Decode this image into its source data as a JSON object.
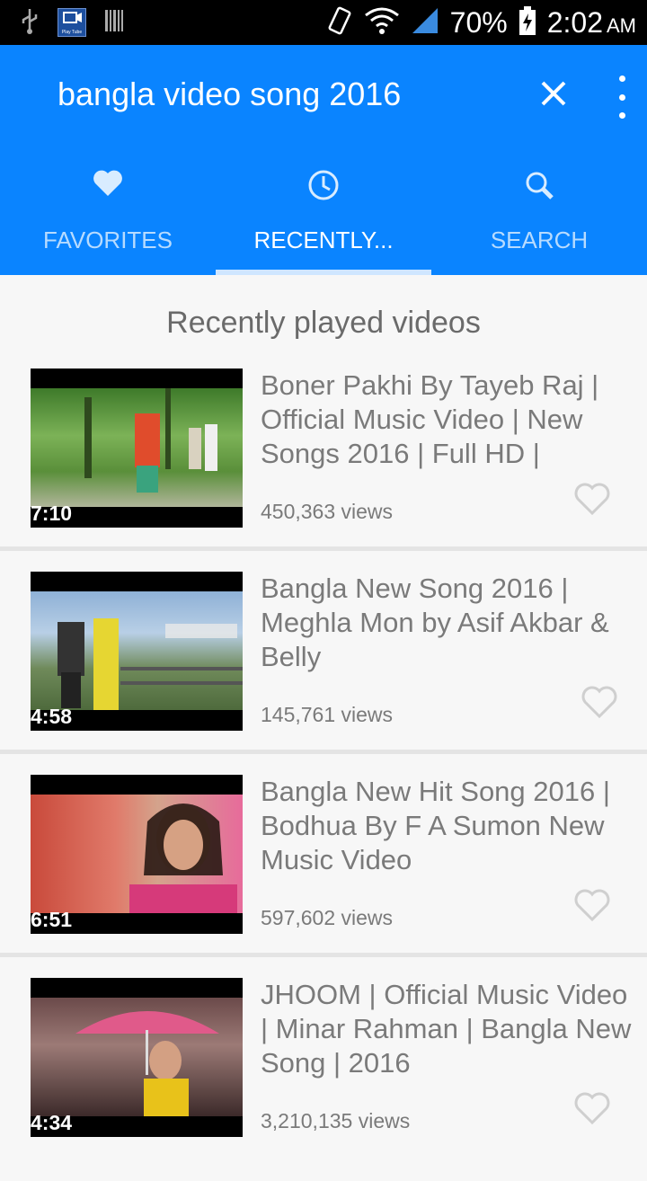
{
  "status_bar": {
    "battery": "70%",
    "time": "2:02",
    "ampm": "AM",
    "notification_app_label": "Play Tube"
  },
  "toolbar": {
    "search_query": "bangla video song 2016"
  },
  "tabs": [
    {
      "label": "FAVORITES",
      "icon": "heart-icon",
      "active": false
    },
    {
      "label": "RECENTLY...",
      "icon": "clock-icon",
      "active": true
    },
    {
      "label": "SEARCH",
      "icon": "search-icon",
      "active": false
    }
  ],
  "section_title": "Recently played videos",
  "videos": [
    {
      "title": "Boner Pakhi By Tayeb Raj  | Official Music Video | New Songs 2016 | Full HD |",
      "views": "450,363 views",
      "duration": "7:10"
    },
    {
      "title": "Bangla New Song 2016 | Meghla Mon by Asif Akbar & Belly",
      "views": "145,761 views",
      "duration": "4:58"
    },
    {
      "title": "Bangla New Hit Song 2016 | Bodhua By F A Sumon New Music Video",
      "views": "597,602 views",
      "duration": "6:51"
    },
    {
      "title": "JHOOM  | Official Music Video | Minar Rahman  | Bangla  New Song | 2016",
      "views": "3,210,135 views",
      "duration": "4:34"
    }
  ],
  "colors": {
    "primary": "#0a84ff",
    "text_secondary": "#7a7a7a"
  }
}
